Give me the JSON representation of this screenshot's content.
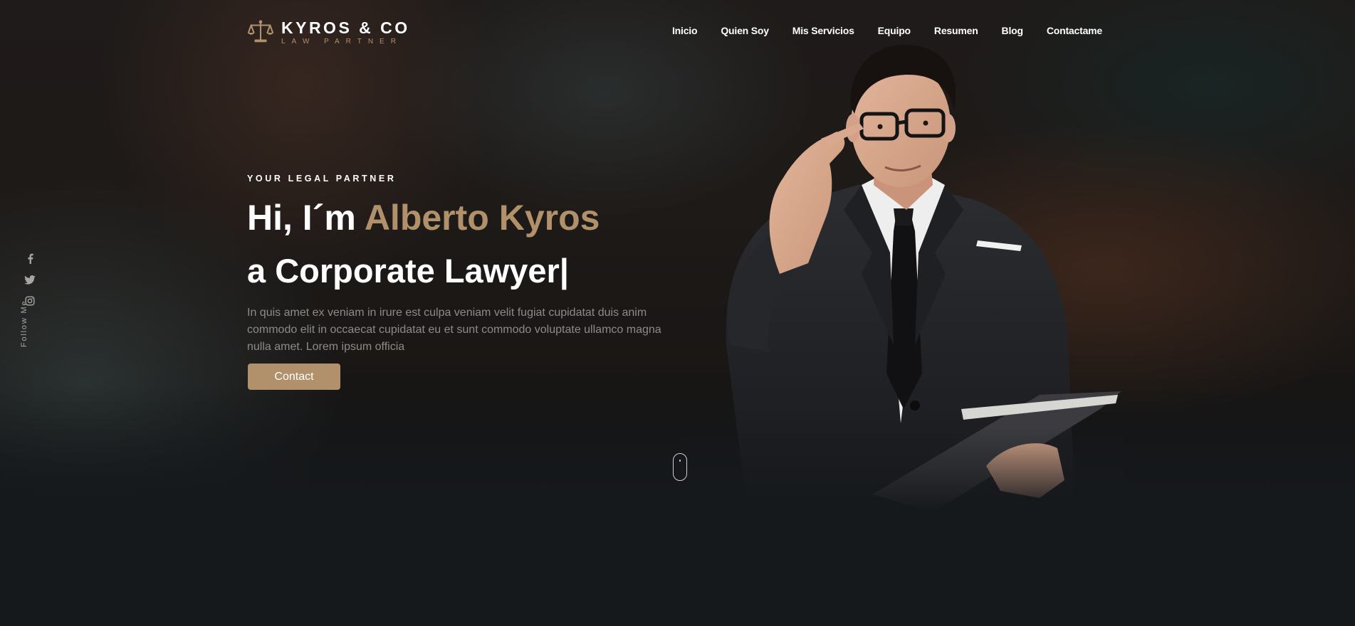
{
  "brand": {
    "name": "KYROS & CO",
    "tagline": "LAW PARTNER"
  },
  "nav": {
    "items": [
      "Inicio",
      "Quien Soy",
      "Mis Servicios",
      "Equipo",
      "Resumen",
      "Blog",
      "Contactame"
    ]
  },
  "social": {
    "icons": [
      "facebook-icon",
      "twitter-icon",
      "instagram-icon"
    ],
    "follow_label": "Follow Me"
  },
  "hero": {
    "eyebrow": "YOUR LEGAL PARTNER",
    "greeting": "Hi, I´m ",
    "name": "Alberto Kyros",
    "role_line": "a Corporate Lawyer|",
    "description": "In quis amet ex veniam in irure est culpa veniam velit fugiat cupidatat duis anim commodo elit in occaecat cupidatat eu et sunt commodo voluptate ullamco magna nulla amet. Lorem ipsum officia",
    "cta_label": "Contact"
  },
  "colors": {
    "accent": "#b0916b",
    "background": "#16191c",
    "muted_text": "#8e8a87"
  }
}
